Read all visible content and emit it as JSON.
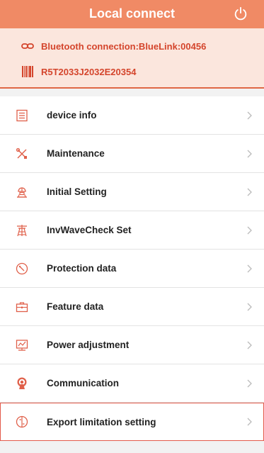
{
  "header": {
    "title": "Local connect",
    "power_icon": "power-icon"
  },
  "connection": {
    "bluetooth_label": "Bluetooth connection:BlueLink:00456",
    "serial": "R5T2033J2032E20354",
    "accent_color": "#d4452c"
  },
  "menu": {
    "items": [
      {
        "label": "device info",
        "icon": "document-list-icon"
      },
      {
        "label": "Maintenance",
        "icon": "tools-icon"
      },
      {
        "label": "Initial Setting",
        "icon": "installer-icon"
      },
      {
        "label": "InvWaveCheck Set",
        "icon": "tower-icon"
      },
      {
        "label": "Protection data",
        "icon": "protection-icon"
      },
      {
        "label": "Feature data",
        "icon": "toolbox-icon"
      },
      {
        "label": "Power adjustment",
        "icon": "monitor-chart-icon"
      },
      {
        "label": "Communication",
        "icon": "signal-icon"
      },
      {
        "label": "Export limitation setting",
        "icon": "meter-icon"
      }
    ]
  },
  "colors": {
    "header_bg": "#f08a65",
    "panel_bg": "#fbe6dd",
    "icon_color": "#e0604a"
  }
}
